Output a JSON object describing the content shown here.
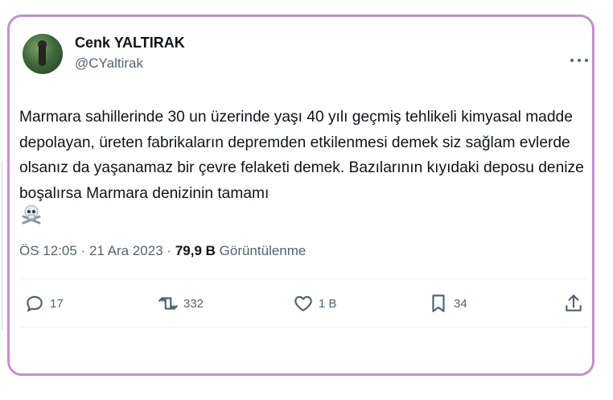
{
  "author": {
    "display_name": "Cenk YALTIRAK",
    "handle": "@CYaltirak"
  },
  "tweet": {
    "text": "Marmara sahillerinde 30 un üzerinde yaşı 40 yılı geçmiş tehlikeli kimyasal madde depolayan, üreten fabrikaların depremden etkilenmesi demek siz sağlam evlerde olsanız da yaşanamaz bir çevre felaketi demek. Bazılarının kıyıdaki deposu denize boşalırsa Marmara denizinin tamamı",
    "emoji_icon": "skull-and-crossbones-icon"
  },
  "meta": {
    "time": "ÖS 12:05",
    "separator": "·",
    "date": "21 Ara 2023",
    "views_count": "79,9 B",
    "views_label": "Görüntülenme"
  },
  "actions": {
    "replies": "17",
    "retweets": "332",
    "likes": "1 B",
    "bookmarks": "34"
  },
  "colors": {
    "frame": "#c58fce",
    "text": "#0f1419",
    "secondary": "#536471"
  }
}
